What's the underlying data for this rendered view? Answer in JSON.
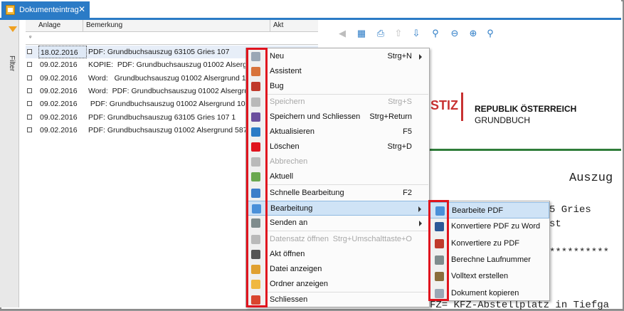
{
  "tab": {
    "title": "Dokumenteintrag",
    "close": "✕"
  },
  "filter": {
    "label": "Filter"
  },
  "grid": {
    "columns": [
      "Anlage",
      "Bemerkung",
      "Akt"
    ],
    "filter_row_icon": "ᵠ",
    "rows": [
      {
        "date": "18.02.2016",
        "note": "PDF: Grundbuchsauszug 63105 Gries 107",
        "selected": true
      },
      {
        "date": "09.02.2016",
        "note": "KOPIE:  PDF: Grundbuchsauszug 01002 Alsergrund 1067"
      },
      {
        "date": "09.02.2016",
        "note": "Word:   Grundbuchsauszug 01002 Alsergrund 1067 1"
      },
      {
        "date": "09.02.2016",
        "note": "Word:  PDF: Grundbuchsauszug 01002 Alsergrund 1067 1"
      },
      {
        "date": "09.02.2016",
        "note": " PDF: Grundbuchsauszug 01002 Alsergrund 1067 1"
      },
      {
        "date": "09.02.2016",
        "note": "PDF: Grundbuchsauszug 63105 Gries 107 1"
      },
      {
        "date": "09.02.2016",
        "note": "PDF: Grundbuchsauszug 01002 Alsergrund 587 1"
      }
    ]
  },
  "viewer": {
    "logo_text": "STIZ",
    "header_line1": "REPUBLIK ÖSTERREICH",
    "header_line2": "GRUNDBUCH",
    "mono_auszug": "Auszug",
    "mono_gries": "5 Gries",
    "mono_st": "st",
    "mono_stars": "**********",
    "mono_bottom": "FZ= KFZ-Abstellplatz in Tiefga"
  },
  "context_menu": {
    "items": [
      {
        "label": "Neu",
        "shortcut": "Strg+N",
        "submenu": true,
        "icon": "new-document-icon",
        "color": "#9aa7b5"
      },
      {
        "label": "Assistent",
        "shortcut": "",
        "icon": "wizard-icon",
        "color": "#d8733a"
      },
      {
        "label": "Bug",
        "shortcut": "",
        "icon": "bug-icon",
        "color": "#c0392b"
      },
      {
        "label": "Speichern",
        "shortcut": "Strg+S",
        "disabled": true,
        "icon": "save-icon",
        "color": "#b9b9b9"
      },
      {
        "label": "Speichern und Schliessen",
        "shortcut": "Strg+Return",
        "icon": "save-close-icon",
        "color": "#6b4f9e"
      },
      {
        "label": "Aktualisieren",
        "shortcut": "F5",
        "icon": "refresh-icon",
        "color": "#2b7bc6"
      },
      {
        "label": "Löschen",
        "shortcut": "Strg+D",
        "icon": "delete-icon",
        "color": "#e0141e"
      },
      {
        "label": "Abbrechen",
        "shortcut": "",
        "disabled": true,
        "icon": "undo-icon",
        "color": "#b9b9b9"
      },
      {
        "label": "Aktuell",
        "shortcut": "",
        "icon": "current-icon",
        "color": "#6aa84f"
      },
      {
        "label": "Schnelle Bearbeitung",
        "shortcut": "F2",
        "icon": "pencil-icon",
        "color": "#3d7ec9"
      },
      {
        "label": "Bearbeitung",
        "shortcut": "",
        "submenu": true,
        "highlighted": true,
        "icon": "edit-document-icon",
        "color": "#4a90d9"
      },
      {
        "label": "Senden an",
        "shortcut": "",
        "submenu": true,
        "icon": "send-icon",
        "color": "#7f8c8d"
      },
      {
        "label": "Datensatz öffnen",
        "shortcut": "Strg+Umschalttaste+O",
        "disabled": true,
        "icon": "open-record-icon",
        "color": "#b9b9b9"
      },
      {
        "label": "Akt öffnen",
        "shortcut": "",
        "icon": "open-file-icon",
        "color": "#555555"
      },
      {
        "label": "Datei anzeigen",
        "shortcut": "",
        "icon": "show-file-icon",
        "color": "#e0a030"
      },
      {
        "label": "Ordner anzeigen",
        "shortcut": "",
        "icon": "folder-icon",
        "color": "#f0b840"
      },
      {
        "label": "Schliessen",
        "shortcut": "",
        "icon": "close-icon",
        "color": "#d9452e"
      }
    ]
  },
  "submenu": {
    "items": [
      {
        "label": "Bearbeite PDF",
        "icon": "edit-pdf-icon",
        "color": "#4a90d9",
        "highlighted": true
      },
      {
        "label": "Konvertiere PDF zu Word",
        "icon": "word-icon",
        "color": "#2b5797"
      },
      {
        "label": "Konvertiere zu PDF",
        "icon": "pdf-icon",
        "color": "#c0392b"
      },
      {
        "label": "Berechne Laufnummer",
        "icon": "calculator-icon",
        "color": "#7f8c8d"
      },
      {
        "label": "Volltext erstellen",
        "icon": "fulltext-icon",
        "color": "#8a6d3b"
      },
      {
        "label": "Dokument kopieren",
        "icon": "copy-icon",
        "color": "#9aa7b5"
      }
    ]
  }
}
